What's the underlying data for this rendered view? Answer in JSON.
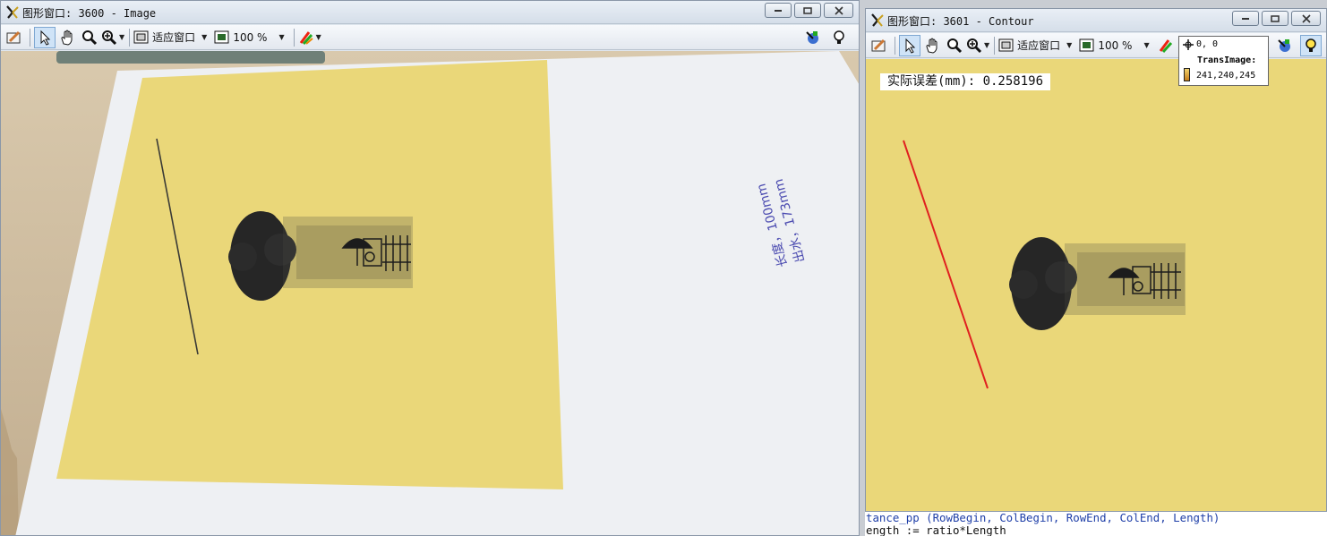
{
  "window1": {
    "title": "图形窗口: 3600 - Image",
    "toolbar": {
      "fit_label": "适应窗口",
      "zoom_label": "100 %"
    },
    "paper_handwriting": [
      "长度，100mm",
      "出水，173mm"
    ]
  },
  "window2": {
    "title": "图形窗口: 3601 - Contour",
    "toolbar": {
      "fit_label": "适应窗口",
      "zoom_label": "100 %"
    },
    "result_text": "实际误差(mm): 0.258196",
    "pixel_info": {
      "coords": "0, 0",
      "image_name": "TransImage:",
      "value": "241,240,245"
    }
  },
  "code_lines": [
    "tance_pp (RowBegin, ColBegin, RowEnd, ColEnd, Length)",
    "ength := ratio*Length"
  ],
  "colors": {
    "paper": "#ead779",
    "red_line": "#e02020",
    "title_bg": "#dbe3ec"
  }
}
